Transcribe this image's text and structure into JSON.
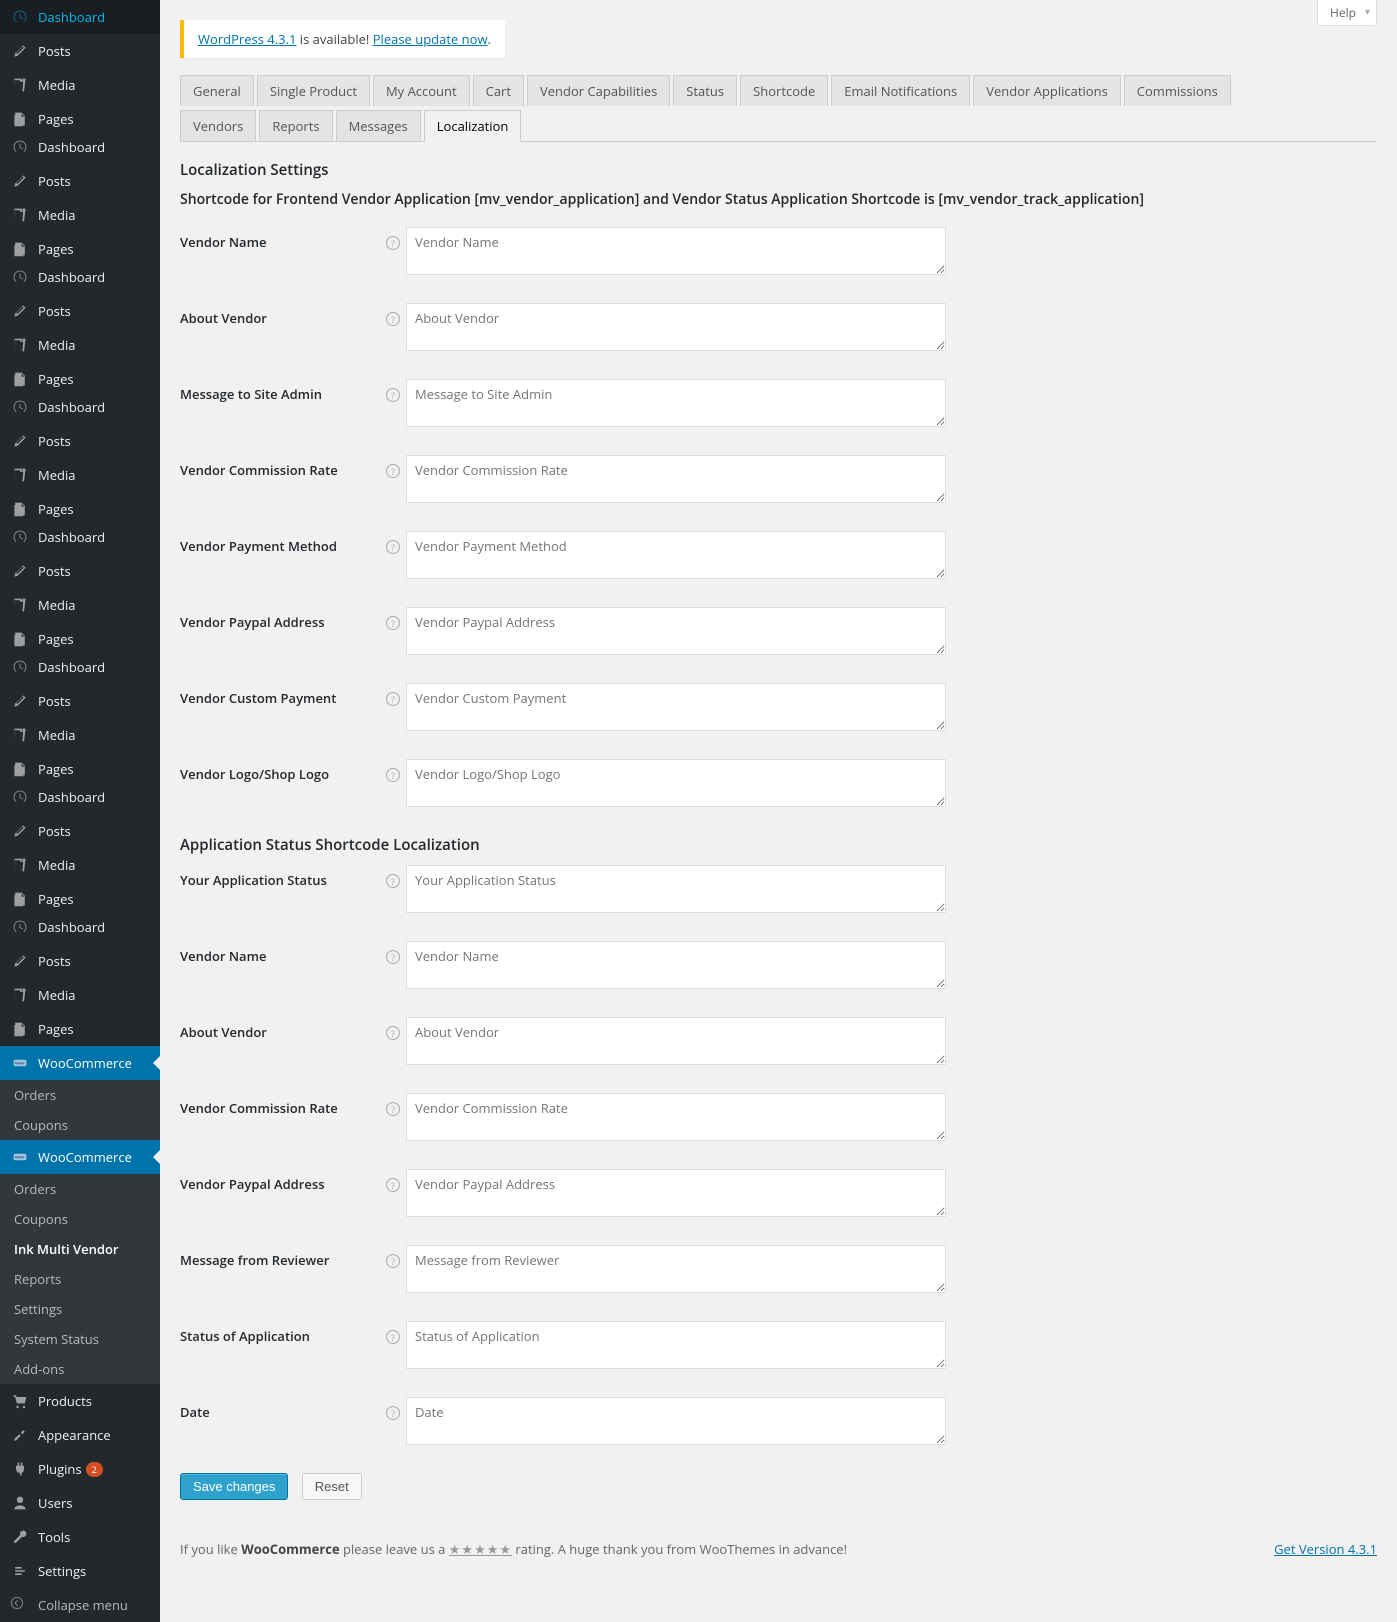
{
  "help": "Help",
  "update": {
    "link1": "WordPress 4.3.1",
    "text1": " is available! ",
    "link2": "Please update now",
    "text2": "."
  },
  "sidebar": {
    "groups": [
      [
        "Dashboard",
        "Posts",
        "Media",
        "Pages"
      ],
      [
        "Dashboard",
        "Posts",
        "Media",
        "Pages"
      ],
      [
        "Dashboard",
        "Posts",
        "Media",
        "Pages"
      ],
      [
        "Dashboard",
        "Posts",
        "Media",
        "Pages"
      ],
      [
        "Dashboard",
        "Posts",
        "Media",
        "Pages"
      ],
      [
        "Dashboard",
        "Posts",
        "Media",
        "Pages"
      ],
      [
        "Dashboard",
        "Posts",
        "Media",
        "Pages"
      ],
      [
        "Dashboard",
        "Posts",
        "Media",
        "Pages"
      ]
    ],
    "woo1": {
      "label": "WooCommerce",
      "sub": [
        "Orders",
        "Coupons"
      ]
    },
    "woo2": {
      "label": "WooCommerce",
      "sub": [
        "Orders",
        "Coupons",
        "Ink Multi Vendor",
        "Reports",
        "Settings",
        "System Status",
        "Add-ons"
      ]
    },
    "rest": [
      {
        "label": "Products",
        "icon": "products"
      },
      {
        "label": "Appearance",
        "icon": "appearance"
      },
      {
        "label": "Plugins",
        "icon": "plugins",
        "badge": "2"
      },
      {
        "label": "Users",
        "icon": "users"
      },
      {
        "label": "Tools",
        "icon": "tools"
      },
      {
        "label": "Settings",
        "icon": "settings"
      }
    ],
    "collapse": "Collapse menu"
  },
  "tabs": {
    "row1": [
      "General",
      "Single Product",
      "My Account",
      "Cart",
      "Vendor Capabilities",
      "Status",
      "Shortcode",
      "Email Notifications",
      "Vendor Applications",
      "Commissions"
    ],
    "row2": [
      "Vendors",
      "Reports",
      "Messages",
      "Localization"
    ],
    "active": "Localization"
  },
  "titles": {
    "sec": "Localization Settings",
    "sub": "Shortcode for Frontend Vendor Application [mv_vendor_application] and Vendor Status Application Shortcode is [mv_vendor_track_application]",
    "sec2": "Application Status Shortcode Localization"
  },
  "fields1": [
    {
      "label": "Vendor Name",
      "ph": "Vendor Name"
    },
    {
      "label": "About Vendor",
      "ph": "About Vendor"
    },
    {
      "label": "Message to Site Admin",
      "ph": "Message to Site Admin"
    },
    {
      "label": "Vendor Commission Rate",
      "ph": "Vendor Commission Rate"
    },
    {
      "label": "Vendor Payment Method",
      "ph": "Vendor Payment Method"
    },
    {
      "label": "Vendor Paypal Address",
      "ph": "Vendor Paypal Address"
    },
    {
      "label": "Vendor Custom Payment",
      "ph": "Vendor Custom Payment"
    },
    {
      "label": "Vendor Logo/Shop Logo",
      "ph": "Vendor Logo/Shop Logo"
    }
  ],
  "fields2": [
    {
      "label": "Your Application Status",
      "ph": "Your Application Status"
    },
    {
      "label": "Vendor Name",
      "ph": "Vendor Name"
    },
    {
      "label": "About Vendor",
      "ph": "About Vendor"
    },
    {
      "label": "Vendor Commission Rate",
      "ph": "Vendor Commission Rate"
    },
    {
      "label": "Vendor Paypal Address",
      "ph": "Vendor Paypal Address"
    },
    {
      "label": "Message from Reviewer",
      "ph": "Message from Reviewer"
    },
    {
      "label": "Status of Application",
      "ph": "Status of Application"
    },
    {
      "label": "Date",
      "ph": "Date"
    }
  ],
  "buttons": {
    "save": "Save changes",
    "reset": "Reset"
  },
  "footer": {
    "t1": "If you like ",
    "brand": "WooCommerce",
    "t2": " please leave us a ",
    "stars": "★★★★★",
    "t3": " rating. A huge thank you from WooThemes in advance!",
    "version": "Get Version 4.3.1"
  }
}
